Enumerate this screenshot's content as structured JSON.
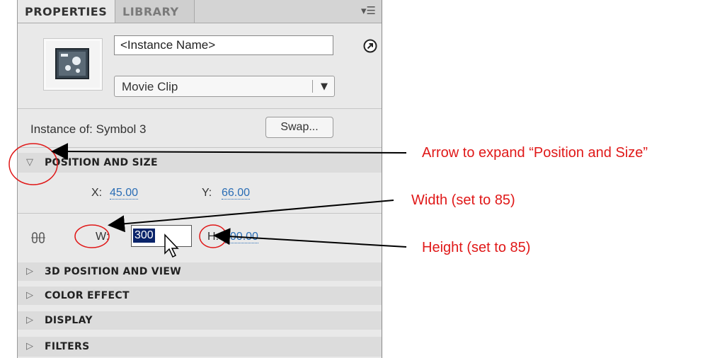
{
  "tabs": {
    "properties": "PROPERTIES",
    "library": "LIBRARY"
  },
  "instance": {
    "name_placeholder": "<Instance Name>",
    "type": "Movie Clip"
  },
  "symbol_row": {
    "instance_of": "Instance of: Symbol 3",
    "swap_label": "Swap..."
  },
  "sections": {
    "position_size": "POSITION AND SIZE",
    "pos3d": "3D POSITION AND VIEW",
    "color_effect": "COLOR EFFECT",
    "display": "DISPLAY",
    "filters": "FILTERS"
  },
  "position": {
    "x_label": "X:",
    "x_value": "45.00",
    "y_label": "Y:",
    "y_value": "66.00"
  },
  "size": {
    "w_label": "W:",
    "w_value": "300",
    "h_label": "H:",
    "h_value": "400.00"
  },
  "annotations": {
    "arrow_expand": "Arrow to expand “Position and Size”",
    "width": "Width (set to 85)",
    "height": "Height (set to 85)"
  },
  "colors": {
    "annotation": "#e01818",
    "link_value": "#2a6db5",
    "selection": "#0a246a"
  },
  "icons": [
    "panel-menu-icon",
    "movie-clip-symbol-icon",
    "go-to-instance-icon",
    "dropdown-arrow-icon",
    "expand-triangle-icon",
    "lock-proportions-icon",
    "mouse-cursor-icon"
  ]
}
